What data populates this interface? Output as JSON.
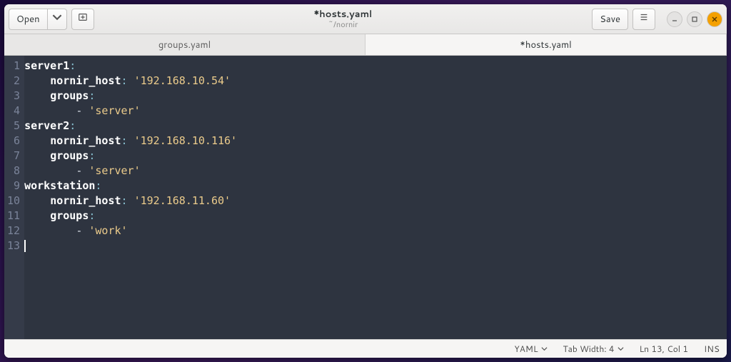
{
  "titlebar": {
    "open_label": "Open",
    "title": "*hosts.yaml",
    "subtitle": "~/nornir",
    "save_label": "Save"
  },
  "tabs": [
    {
      "label": "groups.yaml",
      "active": false
    },
    {
      "label": "*hosts.yaml",
      "active": true
    }
  ],
  "code_lines": [
    [
      {
        "t": "server1",
        "c": "key0"
      },
      {
        "t": ":",
        "c": "colon"
      }
    ],
    [
      {
        "t": "    ",
        "c": ""
      },
      {
        "t": "nornir_host",
        "c": "key1"
      },
      {
        "t": ": ",
        "c": "colon"
      },
      {
        "t": "'192.168.10.54'",
        "c": "str"
      }
    ],
    [
      {
        "t": "    ",
        "c": ""
      },
      {
        "t": "groups",
        "c": "key1"
      },
      {
        "t": ":",
        "c": "colon"
      }
    ],
    [
      {
        "t": "        ",
        "c": ""
      },
      {
        "t": "- ",
        "c": "dash"
      },
      {
        "t": "'server'",
        "c": "str"
      }
    ],
    [
      {
        "t": "server2",
        "c": "key0"
      },
      {
        "t": ":",
        "c": "colon"
      }
    ],
    [
      {
        "t": "    ",
        "c": ""
      },
      {
        "t": "nornir_host",
        "c": "key1"
      },
      {
        "t": ": ",
        "c": "colon"
      },
      {
        "t": "'192.168.10.116'",
        "c": "str"
      }
    ],
    [
      {
        "t": "    ",
        "c": ""
      },
      {
        "t": "groups",
        "c": "key1"
      },
      {
        "t": ":",
        "c": "colon"
      }
    ],
    [
      {
        "t": "        ",
        "c": ""
      },
      {
        "t": "- ",
        "c": "dash"
      },
      {
        "t": "'server'",
        "c": "str"
      }
    ],
    [
      {
        "t": "workstation",
        "c": "key0"
      },
      {
        "t": ":",
        "c": "colon"
      }
    ],
    [
      {
        "t": "    ",
        "c": ""
      },
      {
        "t": "nornir_host",
        "c": "key1"
      },
      {
        "t": ": ",
        "c": "colon"
      },
      {
        "t": "'192.168.11.60'",
        "c": "str"
      }
    ],
    [
      {
        "t": "    ",
        "c": ""
      },
      {
        "t": "groups",
        "c": "key1"
      },
      {
        "t": ":",
        "c": "colon"
      }
    ],
    [
      {
        "t": "        ",
        "c": ""
      },
      {
        "t": "- ",
        "c": "dash"
      },
      {
        "t": "'work'",
        "c": "str"
      }
    ],
    []
  ],
  "statusbar": {
    "language": "YAML",
    "tab_width_label": "Tab Width: 4",
    "position": "Ln 13, Col 1",
    "insert_mode": "INS"
  }
}
